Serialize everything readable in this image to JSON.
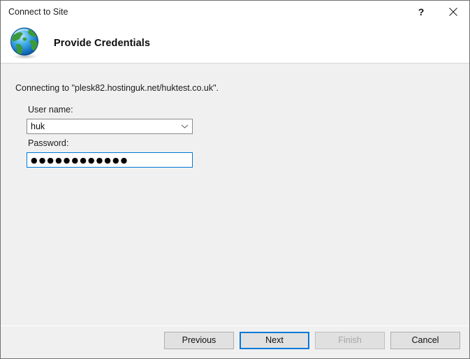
{
  "window": {
    "title": "Connect to Site",
    "help_label": "?",
    "close_label": "✕"
  },
  "header": {
    "icon": "globe-icon",
    "title": "Provide Credentials"
  },
  "content": {
    "intro_text": "Connecting to \"plesk82.hostinguk.net/huktest.co.uk\".",
    "user_name": {
      "label": "User name:",
      "value": "huk",
      "placeholder": "",
      "arrow_icon": "chevron-down-icon"
    },
    "password": {
      "label": "Password:",
      "value": "●●●●●●●●●●●●",
      "placeholder": ""
    }
  },
  "footer": {
    "previous_label": "Previous",
    "next_label": "Next",
    "finish_label": "Finish",
    "cancel_label": "Cancel"
  },
  "colors": {
    "accent": "#0078d7",
    "window_bg": "#f0f0f0",
    "header_bg": "#ffffff",
    "border": "#707070",
    "disabled_text": "#a6a6a6"
  }
}
